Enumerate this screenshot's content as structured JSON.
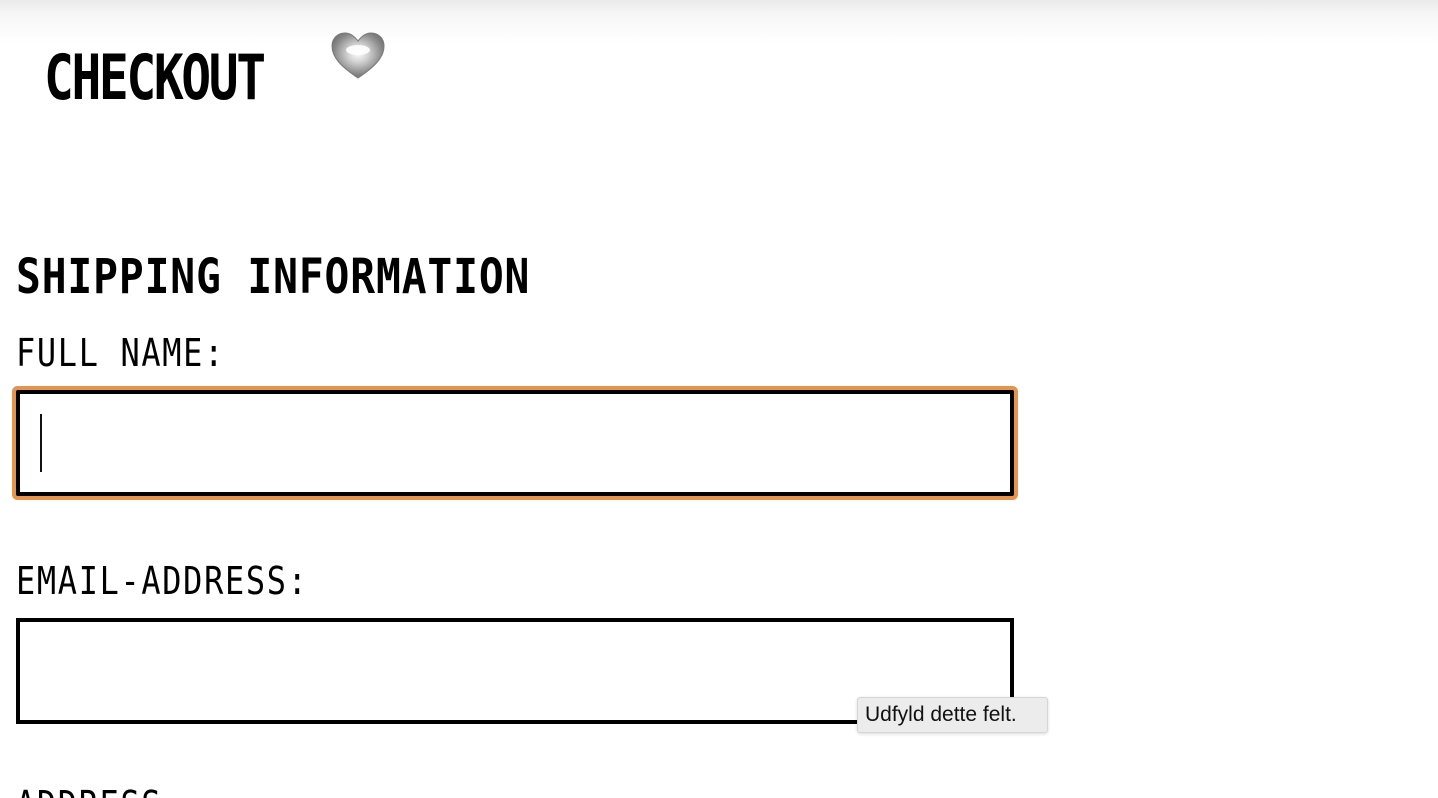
{
  "header": {
    "title": "CHECKOUT",
    "icon": "heart-icon"
  },
  "shipping": {
    "heading": "SHIPPING INFORMATION",
    "fields": [
      {
        "label": "FULL NAME:",
        "value": "",
        "placeholder": "",
        "focused": true
      },
      {
        "label": "EMAIL-ADDRESS:",
        "value": "",
        "placeholder": ""
      },
      {
        "label": "ADDRESS:"
      }
    ]
  },
  "tooltip": {
    "text": "Udfyld dette felt."
  },
  "colors": {
    "focus_ring": "#e5934d",
    "border": "#000000",
    "tooltip_bg": "#ececec"
  }
}
